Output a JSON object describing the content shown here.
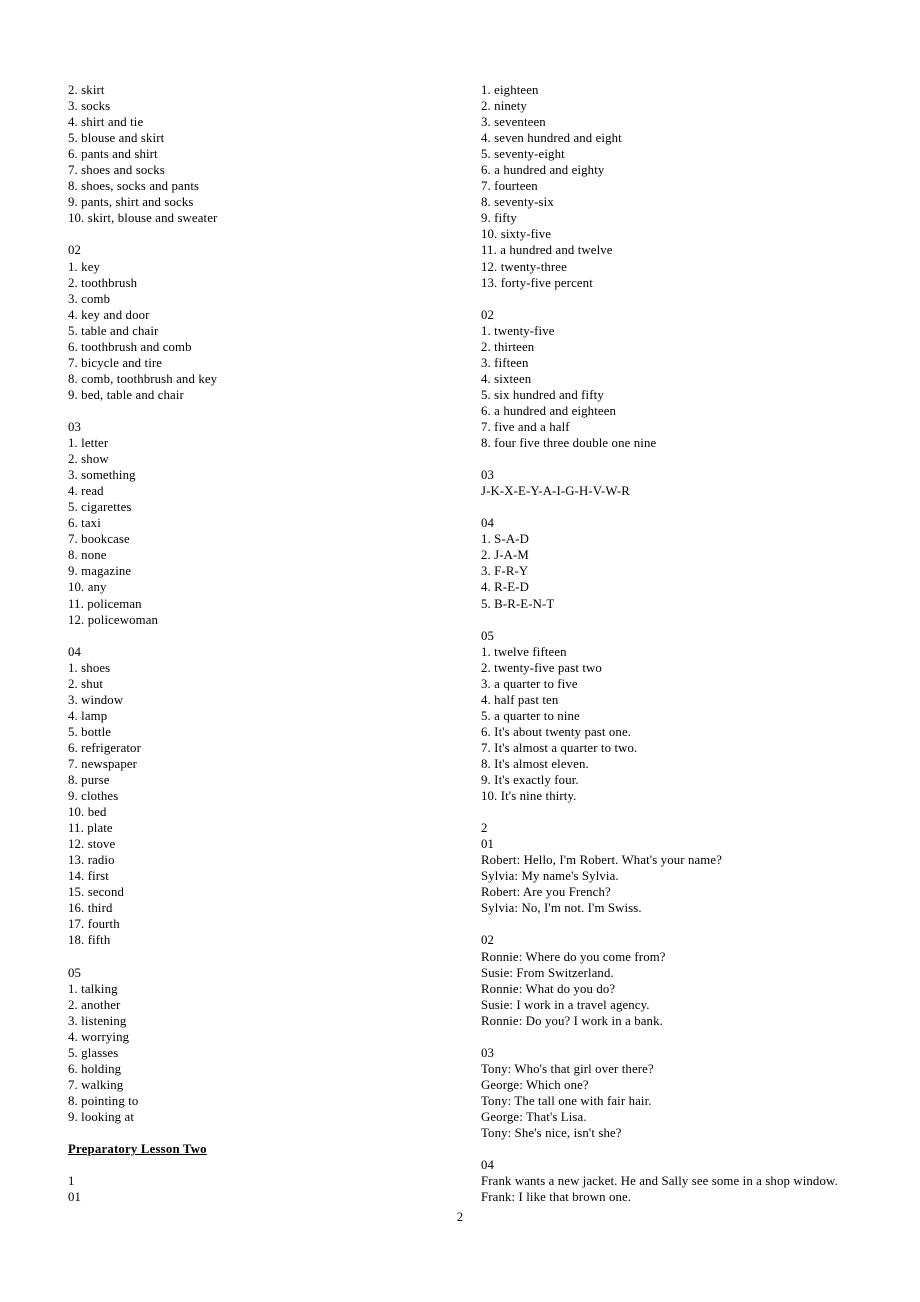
{
  "document": {
    "page_number": "2",
    "left_column": [
      {
        "text": "2. skirt",
        "style": "normal"
      },
      {
        "text": "3. socks",
        "style": "normal"
      },
      {
        "text": "4. shirt and tie",
        "style": "normal"
      },
      {
        "text": "5. blouse and skirt",
        "style": "normal"
      },
      {
        "text": "6. pants and shirt",
        "style": "normal"
      },
      {
        "text": "7. shoes and socks",
        "style": "normal"
      },
      {
        "text": "8. shoes, socks and pants",
        "style": "normal"
      },
      {
        "text": "9. pants, shirt and socks",
        "style": "normal"
      },
      {
        "text": "10. skirt, blouse and sweater",
        "style": "normal"
      },
      {
        "text": "",
        "style": "blank"
      },
      {
        "text": "02",
        "style": "normal"
      },
      {
        "text": "1. key",
        "style": "normal"
      },
      {
        "text": "2. toothbrush",
        "style": "normal"
      },
      {
        "text": "3. comb",
        "style": "normal"
      },
      {
        "text": "4. key and door",
        "style": "normal"
      },
      {
        "text": "5. table and chair",
        "style": "normal"
      },
      {
        "text": "6. toothbrush and comb",
        "style": "normal"
      },
      {
        "text": "7. bicycle and tire",
        "style": "normal"
      },
      {
        "text": "8. comb, toothbrush and key",
        "style": "normal"
      },
      {
        "text": "9. bed, table and chair",
        "style": "normal"
      },
      {
        "text": "",
        "style": "blank"
      },
      {
        "text": "03",
        "style": "normal"
      },
      {
        "text": "1. letter",
        "style": "normal"
      },
      {
        "text": "2. show",
        "style": "normal"
      },
      {
        "text": "3. something",
        "style": "normal"
      },
      {
        "text": "4. read",
        "style": "normal"
      },
      {
        "text": "5. cigarettes",
        "style": "normal"
      },
      {
        "text": "6. taxi",
        "style": "normal"
      },
      {
        "text": "7. bookcase",
        "style": "normal"
      },
      {
        "text": "8. none",
        "style": "normal"
      },
      {
        "text": "9. magazine",
        "style": "normal"
      },
      {
        "text": "10. any",
        "style": "normal"
      },
      {
        "text": "11. policeman",
        "style": "normal"
      },
      {
        "text": "12. policewoman",
        "style": "normal"
      },
      {
        "text": "",
        "style": "blank"
      },
      {
        "text": "04",
        "style": "normal"
      },
      {
        "text": "1. shoes",
        "style": "normal"
      },
      {
        "text": "2. shut",
        "style": "normal"
      },
      {
        "text": "3. window",
        "style": "normal"
      },
      {
        "text": "4. lamp",
        "style": "normal"
      },
      {
        "text": "5. bottle",
        "style": "normal"
      },
      {
        "text": "6. refrigerator",
        "style": "normal"
      },
      {
        "text": "7. newspaper",
        "style": "normal"
      },
      {
        "text": "8. purse",
        "style": "normal"
      },
      {
        "text": "9. clothes",
        "style": "normal"
      },
      {
        "text": "10. bed",
        "style": "normal"
      },
      {
        "text": "11. plate",
        "style": "normal"
      },
      {
        "text": "12. stove",
        "style": "normal"
      },
      {
        "text": "13. radio",
        "style": "normal"
      },
      {
        "text": "14. first",
        "style": "normal"
      },
      {
        "text": "15. second",
        "style": "normal"
      },
      {
        "text": "16. third",
        "style": "normal"
      },
      {
        "text": "17. fourth",
        "style": "normal"
      },
      {
        "text": "18. fifth",
        "style": "normal"
      },
      {
        "text": "",
        "style": "blank"
      },
      {
        "text": "05",
        "style": "normal"
      },
      {
        "text": "1. talking",
        "style": "normal"
      },
      {
        "text": "2. another",
        "style": "normal"
      },
      {
        "text": "3. listening",
        "style": "normal"
      },
      {
        "text": "4. worrying",
        "style": "normal"
      },
      {
        "text": "5. glasses",
        "style": "normal"
      },
      {
        "text": "6. holding",
        "style": "normal"
      },
      {
        "text": "7. walking",
        "style": "normal"
      },
      {
        "text": "8. pointing to",
        "style": "normal"
      },
      {
        "text": "9. looking at",
        "style": "normal"
      },
      {
        "text": "",
        "style": "blank"
      },
      {
        "text": "Preparatory Lesson Two",
        "style": "heading"
      },
      {
        "text": "",
        "style": "blank"
      },
      {
        "text": "1",
        "style": "normal"
      },
      {
        "text": "01",
        "style": "normal"
      }
    ],
    "right_column": [
      {
        "text": "1. eighteen",
        "style": "normal"
      },
      {
        "text": "2. ninety",
        "style": "normal"
      },
      {
        "text": "3. seventeen",
        "style": "normal"
      },
      {
        "text": "4. seven hundred and eight",
        "style": "normal"
      },
      {
        "text": "5. seventy-eight",
        "style": "normal"
      },
      {
        "text": "6. a hundred and eighty",
        "style": "normal"
      },
      {
        "text": "7. fourteen",
        "style": "normal"
      },
      {
        "text": "8. seventy-six",
        "style": "normal"
      },
      {
        "text": "9. fifty",
        "style": "normal"
      },
      {
        "text": "10. sixty-five",
        "style": "normal"
      },
      {
        "text": "11. a hundred and twelve",
        "style": "normal"
      },
      {
        "text": "12. twenty-three",
        "style": "normal"
      },
      {
        "text": "13. forty-five percent",
        "style": "normal"
      },
      {
        "text": "",
        "style": "blank"
      },
      {
        "text": "02",
        "style": "normal"
      },
      {
        "text": "1. twenty-five",
        "style": "normal"
      },
      {
        "text": "2. thirteen",
        "style": "normal"
      },
      {
        "text": "3. fifteen",
        "style": "normal"
      },
      {
        "text": "4. sixteen",
        "style": "normal"
      },
      {
        "text": "5. six hundred and fifty",
        "style": "normal"
      },
      {
        "text": "6. a hundred and eighteen",
        "style": "normal"
      },
      {
        "text": "7. five and a half",
        "style": "normal"
      },
      {
        "text": "8. four five three double one nine",
        "style": "normal"
      },
      {
        "text": "",
        "style": "blank"
      },
      {
        "text": "03",
        "style": "normal"
      },
      {
        "text": "J-K-X-E-Y-A-I-G-H-V-W-R",
        "style": "normal"
      },
      {
        "text": "",
        "style": "blank"
      },
      {
        "text": "04",
        "style": "normal"
      },
      {
        "text": "1. S-A-D",
        "style": "normal"
      },
      {
        "text": "2. J-A-M",
        "style": "normal"
      },
      {
        "text": "3. F-R-Y",
        "style": "normal"
      },
      {
        "text": "4. R-E-D",
        "style": "normal"
      },
      {
        "text": "5. B-R-E-N-T",
        "style": "normal"
      },
      {
        "text": "",
        "style": "blank"
      },
      {
        "text": "05",
        "style": "normal"
      },
      {
        "text": "1. twelve fifteen",
        "style": "normal"
      },
      {
        "text": "2. twenty-five past two",
        "style": "normal"
      },
      {
        "text": "3. a quarter to five",
        "style": "normal"
      },
      {
        "text": "4. half past ten",
        "style": "normal"
      },
      {
        "text": "5. a quarter to nine",
        "style": "normal"
      },
      {
        "text": "6. It's about twenty past one.",
        "style": "normal"
      },
      {
        "text": "7. It's almost a quarter to two.",
        "style": "normal"
      },
      {
        "text": "8. It's almost eleven.",
        "style": "normal"
      },
      {
        "text": "9. It's exactly four.",
        "style": "normal"
      },
      {
        "text": "10. It's nine thirty.",
        "style": "normal"
      },
      {
        "text": "",
        "style": "blank"
      },
      {
        "text": "2",
        "style": "normal"
      },
      {
        "text": "01",
        "style": "normal"
      },
      {
        "text": "Robert: Hello, I'm Robert. What's your name?",
        "style": "normal"
      },
      {
        "text": "Sylvia: My name's Sylvia.",
        "style": "normal"
      },
      {
        "text": "Robert: Are you French?",
        "style": "normal"
      },
      {
        "text": "Sylvia: No, I'm not. I'm Swiss.",
        "style": "normal"
      },
      {
        "text": "",
        "style": "blank"
      },
      {
        "text": "02",
        "style": "normal"
      },
      {
        "text": "Ronnie: Where do you come from?",
        "style": "normal"
      },
      {
        "text": "Susie: From Switzerland.",
        "style": "normal"
      },
      {
        "text": "Ronnie: What do you do?",
        "style": "normal"
      },
      {
        "text": "Susie: I work in a travel agency.",
        "style": "normal"
      },
      {
        "text": "Ronnie: Do you? I work in a bank.",
        "style": "normal"
      },
      {
        "text": "",
        "style": "blank"
      },
      {
        "text": "03",
        "style": "normal"
      },
      {
        "text": "Tony: Who's that girl over there?",
        "style": "normal"
      },
      {
        "text": "George: Which one?",
        "style": "normal"
      },
      {
        "text": "Tony: The tall one with fair hair.",
        "style": "normal"
      },
      {
        "text": "George: That's Lisa.",
        "style": "normal"
      },
      {
        "text": "Tony: She's nice, isn't she?",
        "style": "normal"
      },
      {
        "text": "",
        "style": "blank"
      },
      {
        "text": "04",
        "style": "normal"
      },
      {
        "text": "Frank wants a new jacket. He and Sally see some in a shop window.",
        "style": "normal"
      },
      {
        "text": "Frank: I like that brown one.",
        "style": "normal"
      }
    ]
  }
}
